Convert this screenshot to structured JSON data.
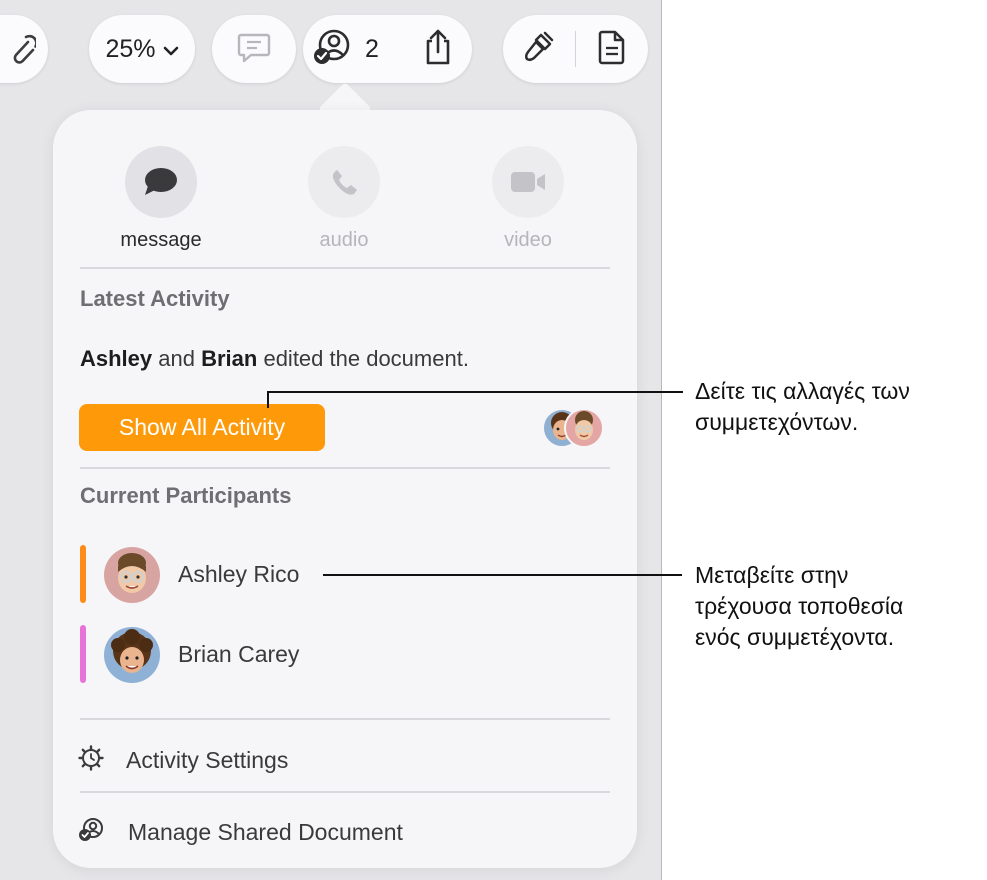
{
  "toolbar": {
    "zoom_value": "25%",
    "collaborators_count": "2"
  },
  "popover": {
    "communication": [
      {
        "label": "message",
        "icon": "message-bubble-icon",
        "enabled": true
      },
      {
        "label": "audio",
        "icon": "phone-icon",
        "enabled": false
      },
      {
        "label": "video",
        "icon": "video-camera-icon",
        "enabled": false
      }
    ],
    "latest_activity": {
      "title": "Latest Activity",
      "editor1": "Ashley",
      "joiner": " and ",
      "editor2": "Brian",
      "suffix": " edited the document.",
      "button_label": "Show All Activity"
    },
    "current_participants": {
      "title": "Current Participants",
      "people": [
        {
          "name": "Ashley Rico",
          "color": "#fe8c1a"
        },
        {
          "name": "Brian Carey",
          "color": "#e773d8"
        }
      ]
    },
    "menu": {
      "activity_settings": "Activity Settings",
      "manage_shared_document": "Manage Shared Document"
    }
  },
  "callouts": {
    "activity": {
      "line1": "Δείτε τις αλλαγές των",
      "line2": "συμμετεχόντων."
    },
    "participant": {
      "line1": "Μεταβείτε στην",
      "line2": "τρέχουσα τοποθεσία",
      "line3": "ενός συμμετέχοντα."
    }
  },
  "colors": {
    "accent_orange": "#fe9a0a",
    "participant1_color": "#fe8c1a",
    "participant2_color": "#e773d8"
  }
}
